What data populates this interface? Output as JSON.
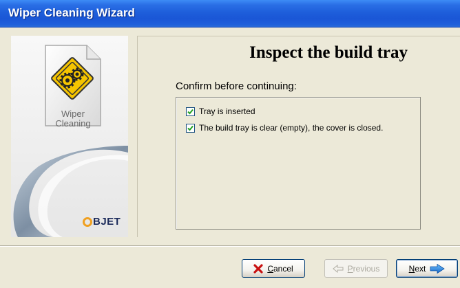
{
  "window": {
    "title": "Wiper Cleaning Wizard"
  },
  "sidebar": {
    "icon_name": "gears-document-icon",
    "icon_label_line1": "Wiper",
    "icon_label_line2": "Cleaning",
    "logo_text": "BJET"
  },
  "content": {
    "heading": "Inspect the build tray",
    "subheading": "Confirm before continuing:",
    "checklist": [
      {
        "label": "Tray is inserted",
        "checked": true
      },
      {
        "label": "The build tray is clear (empty), the cover is closed.",
        "checked": true
      }
    ]
  },
  "buttons": {
    "cancel": {
      "mnemonic": "C",
      "rest": "ancel"
    },
    "previous": {
      "mnemonic": "P",
      "rest": "revious"
    },
    "next": {
      "mnemonic": "N",
      "rest": "ext"
    }
  },
  "colors": {
    "titlebar": "#1e5fdb",
    "dialog_bg": "#ece9d8",
    "accent_orange": "#f0a020",
    "next_arrow": "#1e90ff"
  }
}
